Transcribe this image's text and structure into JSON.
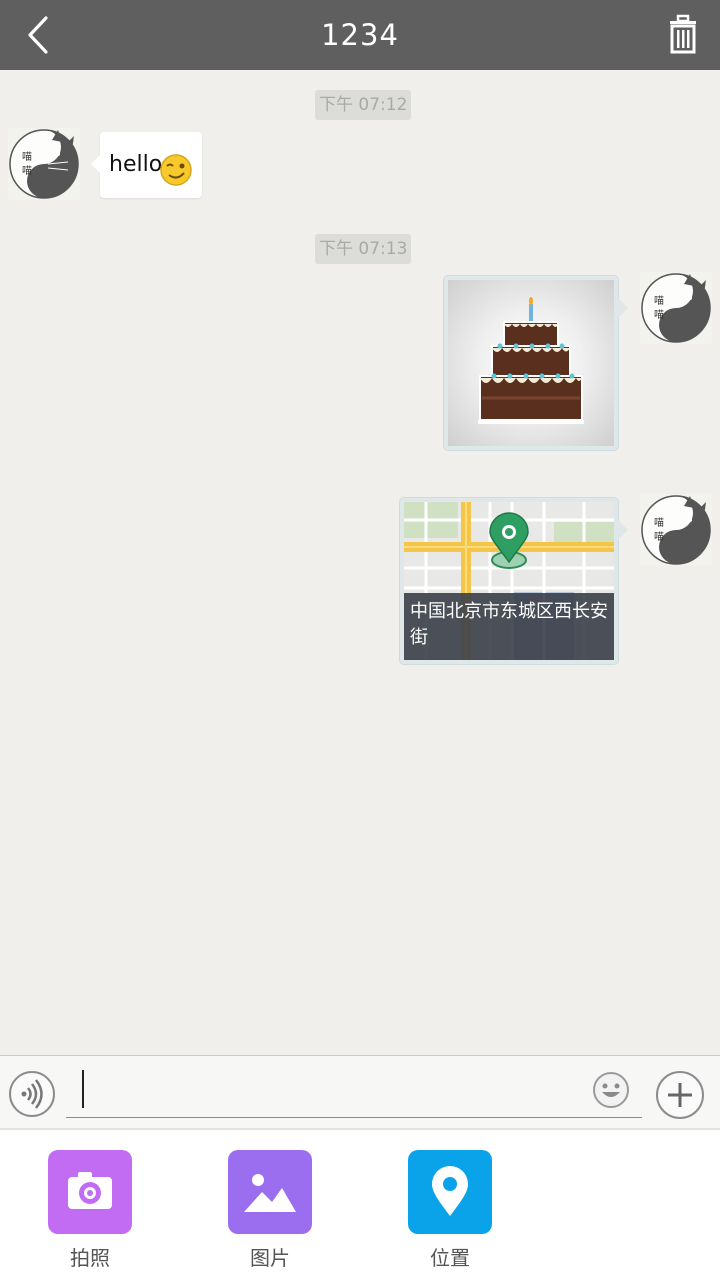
{
  "header": {
    "title": "1234",
    "back_icon": "back-chevron-icon",
    "delete_icon": "trash-icon",
    "background": "#5f5f5f"
  },
  "messages": [
    {
      "type": "time",
      "text": "下午 07:12"
    },
    {
      "type": "text",
      "side": "left",
      "text": "hello",
      "emoji": "wink-emoji"
    },
    {
      "type": "time",
      "text": "下午 07:13"
    },
    {
      "type": "image",
      "side": "right",
      "image": "birthday-cake-sticker"
    },
    {
      "type": "location",
      "side": "right",
      "address": "中国北京市东城区西长安街"
    }
  ],
  "input": {
    "value": "",
    "voice_icon": "voice-wave-icon",
    "emoji_icon": "smiley-icon",
    "more_icon": "plus-icon",
    "underline_color": "#4aa3c9"
  },
  "tools": [
    {
      "label": "拍照",
      "icon": "camera-icon",
      "color": "#c16cf2"
    },
    {
      "label": "图片",
      "icon": "picture-icon",
      "color": "#9b6ef0"
    },
    {
      "label": "位置",
      "icon": "location-pin-icon",
      "color": "#0aa3e9"
    }
  ]
}
